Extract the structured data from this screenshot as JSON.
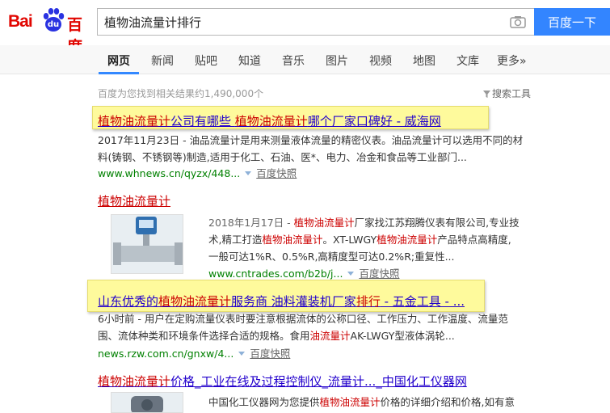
{
  "logo": {
    "latin": "Bai",
    "paw": "du",
    "cn": "百度"
  },
  "search": {
    "value": "植物油流量计排行",
    "button": "百度一下"
  },
  "tabs": [
    "网页",
    "新闻",
    "贴吧",
    "知道",
    "音乐",
    "图片",
    "视频",
    "地图",
    "文库",
    "更多»"
  ],
  "summary": {
    "count_text": "百度为您找到相关结果约1,490,000个",
    "tools_label": "搜索工具"
  },
  "results": [
    {
      "title_parts": [
        "植物油流量计",
        "公司有哪些 ",
        "植物油流量计",
        "哪个厂家口碑好 - 威海网"
      ],
      "line1": "2017年11月23日 - 油品流量计是用来测量液体流量的精密仪表。油品流量计可以选用不同的材",
      "line2": "料(铸钢、不锈钢等)制造,适用于化工、石油、医*、电力、冶金和食品等工业部门...",
      "url": "www.whnews.cn/qyzx/448...",
      "snap": "百度快照"
    },
    {
      "title": "植物油流量计",
      "line1_date": "2018年1月17日 - ",
      "line1_a": "植物油流量计",
      "line1_b": "厂家找江苏翔腾仪表有限公司,专业技",
      "line2_a": "术,精工打造",
      "line2_b": "植物油流量计",
      "line2_c": "。XT-LWGY",
      "line2_d": "植物油流量计",
      "line2_e": "产品特点高精度,",
      "line3": "一般可达1%R、0.5%R,高精度型可达0.2%R;重复性...",
      "url": "www.cntrades.com/b2b/j...",
      "snap": "百度快照"
    },
    {
      "title_parts": [
        "山东优秀的",
        "植物油流量计",
        "服务商 油料灌装机厂家",
        "排行",
        " - 五金工具 - ..."
      ],
      "line1": "6小时前 - 用户在定购流量仪表时要注意根据流体的公称口径、工作压力、工作温度、流量范",
      "line2_a": "围、流体种类和环境条件选择合适的规格。食用",
      "line2_b": "油流量计",
      "line2_c": "AK-LWGY型液体涡轮...",
      "url": "news.rzw.com.cn/gnxw/4...",
      "snap": "百度快照"
    },
    {
      "title_parts": [
        "植物油流量计",
        "价格_工业在线及过程控制仪_流量计..._中国化工仪器网"
      ],
      "line1_a": "中国化工仪器网为您提供",
      "line1_b": "植物油流量计",
      "line1_c": "价格的详细介绍和价格,如有意"
    }
  ],
  "colors": {
    "link": "#2200cc",
    "highlight": "#cc0000",
    "url": "#008000",
    "button": "#3385ff",
    "brand_red": "#e10601",
    "sticky_note": "#fefa9c"
  }
}
